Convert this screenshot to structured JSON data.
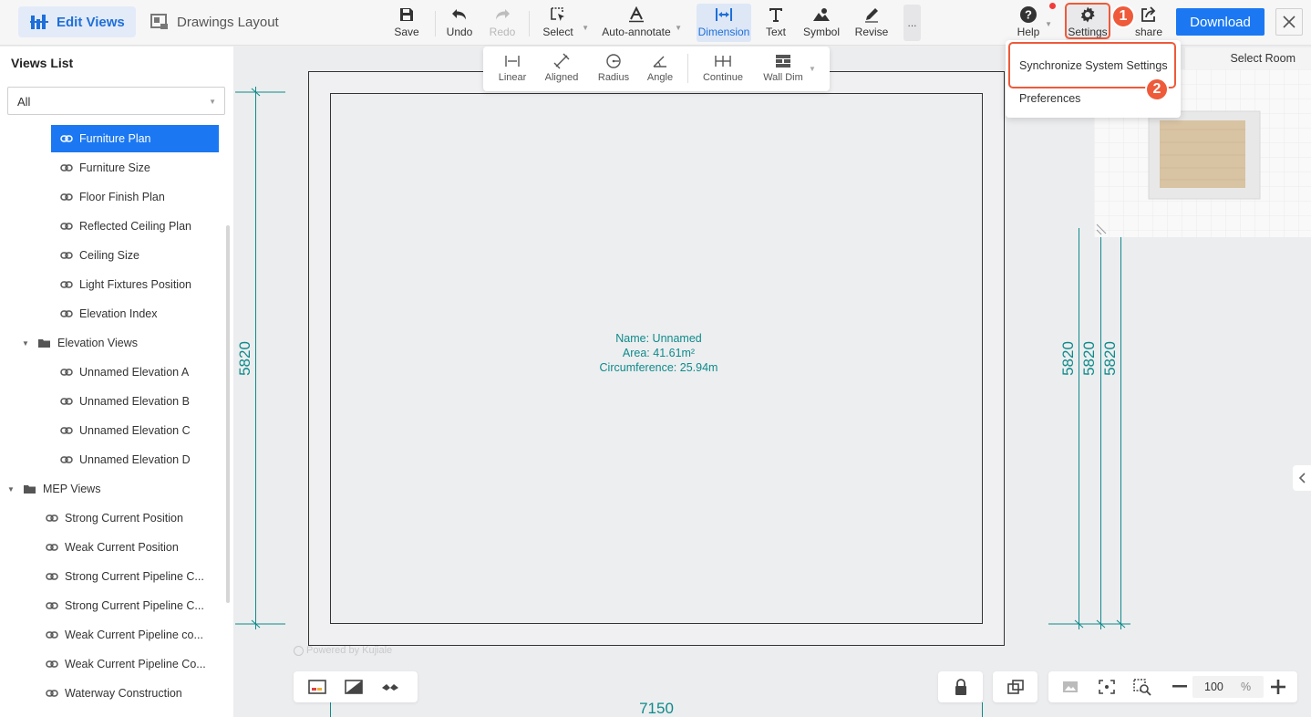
{
  "header": {
    "modes": [
      {
        "label": "Edit Views",
        "active": true
      },
      {
        "label": "Drawings Layout",
        "active": false
      }
    ],
    "tools": [
      {
        "label": "Save",
        "icon": "save-icon"
      },
      {
        "label": "Undo",
        "icon": "undo-icon"
      },
      {
        "label": "Redo",
        "icon": "redo-icon",
        "disabled": true
      },
      {
        "label": "Select",
        "icon": "select-icon"
      },
      {
        "label": "Auto-annotate",
        "icon": "auto-annotate-icon"
      },
      {
        "label": "Dimension",
        "icon": "dimension-icon",
        "active": true
      },
      {
        "label": "Text",
        "icon": "text-icon"
      },
      {
        "label": "Symbol",
        "icon": "symbol-icon"
      },
      {
        "label": "Revise",
        "icon": "revise-icon"
      }
    ],
    "more_label": "...",
    "help_label": "Help",
    "settings_label": "Settings",
    "share_label": "share",
    "download_label": "Download"
  },
  "dimension_tools": [
    {
      "label": "Linear",
      "icon": "linear-dim-icon"
    },
    {
      "label": "Aligned",
      "icon": "aligned-dim-icon"
    },
    {
      "label": "Radius",
      "icon": "radius-dim-icon"
    },
    {
      "label": "Angle",
      "icon": "angle-dim-icon"
    },
    {
      "label": "Continue",
      "icon": "continue-dim-icon"
    },
    {
      "label": "Wall Dim",
      "icon": "wall-dim-icon"
    }
  ],
  "settings_menu": {
    "items": [
      "Synchronize System Settings",
      "Preferences"
    ]
  },
  "annotations": {
    "step1": "1",
    "step2": "2"
  },
  "sidebar": {
    "title": "Views List",
    "filter": "All",
    "items": [
      {
        "label": "Furniture Plan",
        "type": "view",
        "level": 2,
        "selected": true
      },
      {
        "label": "Furniture Size",
        "type": "view",
        "level": 2
      },
      {
        "label": "Floor Finish Plan",
        "type": "view",
        "level": 2
      },
      {
        "label": "Reflected Ceiling Plan",
        "type": "view",
        "level": 2
      },
      {
        "label": "Ceiling Size",
        "type": "view",
        "level": 2
      },
      {
        "label": "Light Fixtures Position",
        "type": "view",
        "level": 2
      },
      {
        "label": "Elevation Index",
        "type": "view",
        "level": 2
      },
      {
        "label": "Elevation Views",
        "type": "folder",
        "level": 1
      },
      {
        "label": "Unnamed Elevation A",
        "type": "view",
        "level": 2
      },
      {
        "label": "Unnamed Elevation B",
        "type": "view",
        "level": 2
      },
      {
        "label": "Unnamed Elevation C",
        "type": "view",
        "level": 2
      },
      {
        "label": "Unnamed Elevation D",
        "type": "view",
        "level": 2
      },
      {
        "label": "MEP Views",
        "type": "folder",
        "level": 0
      },
      {
        "label": "Strong Current Position",
        "type": "view",
        "level": 1
      },
      {
        "label": "Weak Current Position",
        "type": "view",
        "level": 1
      },
      {
        "label": "Strong Current Pipeline C...",
        "type": "view",
        "level": 1
      },
      {
        "label": "Strong Current Pipeline C...",
        "type": "view",
        "level": 1
      },
      {
        "label": "Weak Current Pipeline co...",
        "type": "view",
        "level": 1
      },
      {
        "label": "Weak Current Pipeline Co...",
        "type": "view",
        "level": 1
      },
      {
        "label": "Waterway Construction",
        "type": "view",
        "level": 1
      }
    ]
  },
  "canvas": {
    "room_name": "Name: Unnamed",
    "room_area": "Area: 41.61m²",
    "room_circumference": "Circumference: 25.94m",
    "dim_left": "5820",
    "dim_right": [
      "5820",
      "5820",
      "5820"
    ],
    "dim_bottom": "7150",
    "watermark": "Powered by Kujiale",
    "dim_color": "#0e8a8a"
  },
  "minimap": {
    "select_room_label": "Select Room"
  },
  "zoom": {
    "value": "100",
    "unit": "%"
  }
}
